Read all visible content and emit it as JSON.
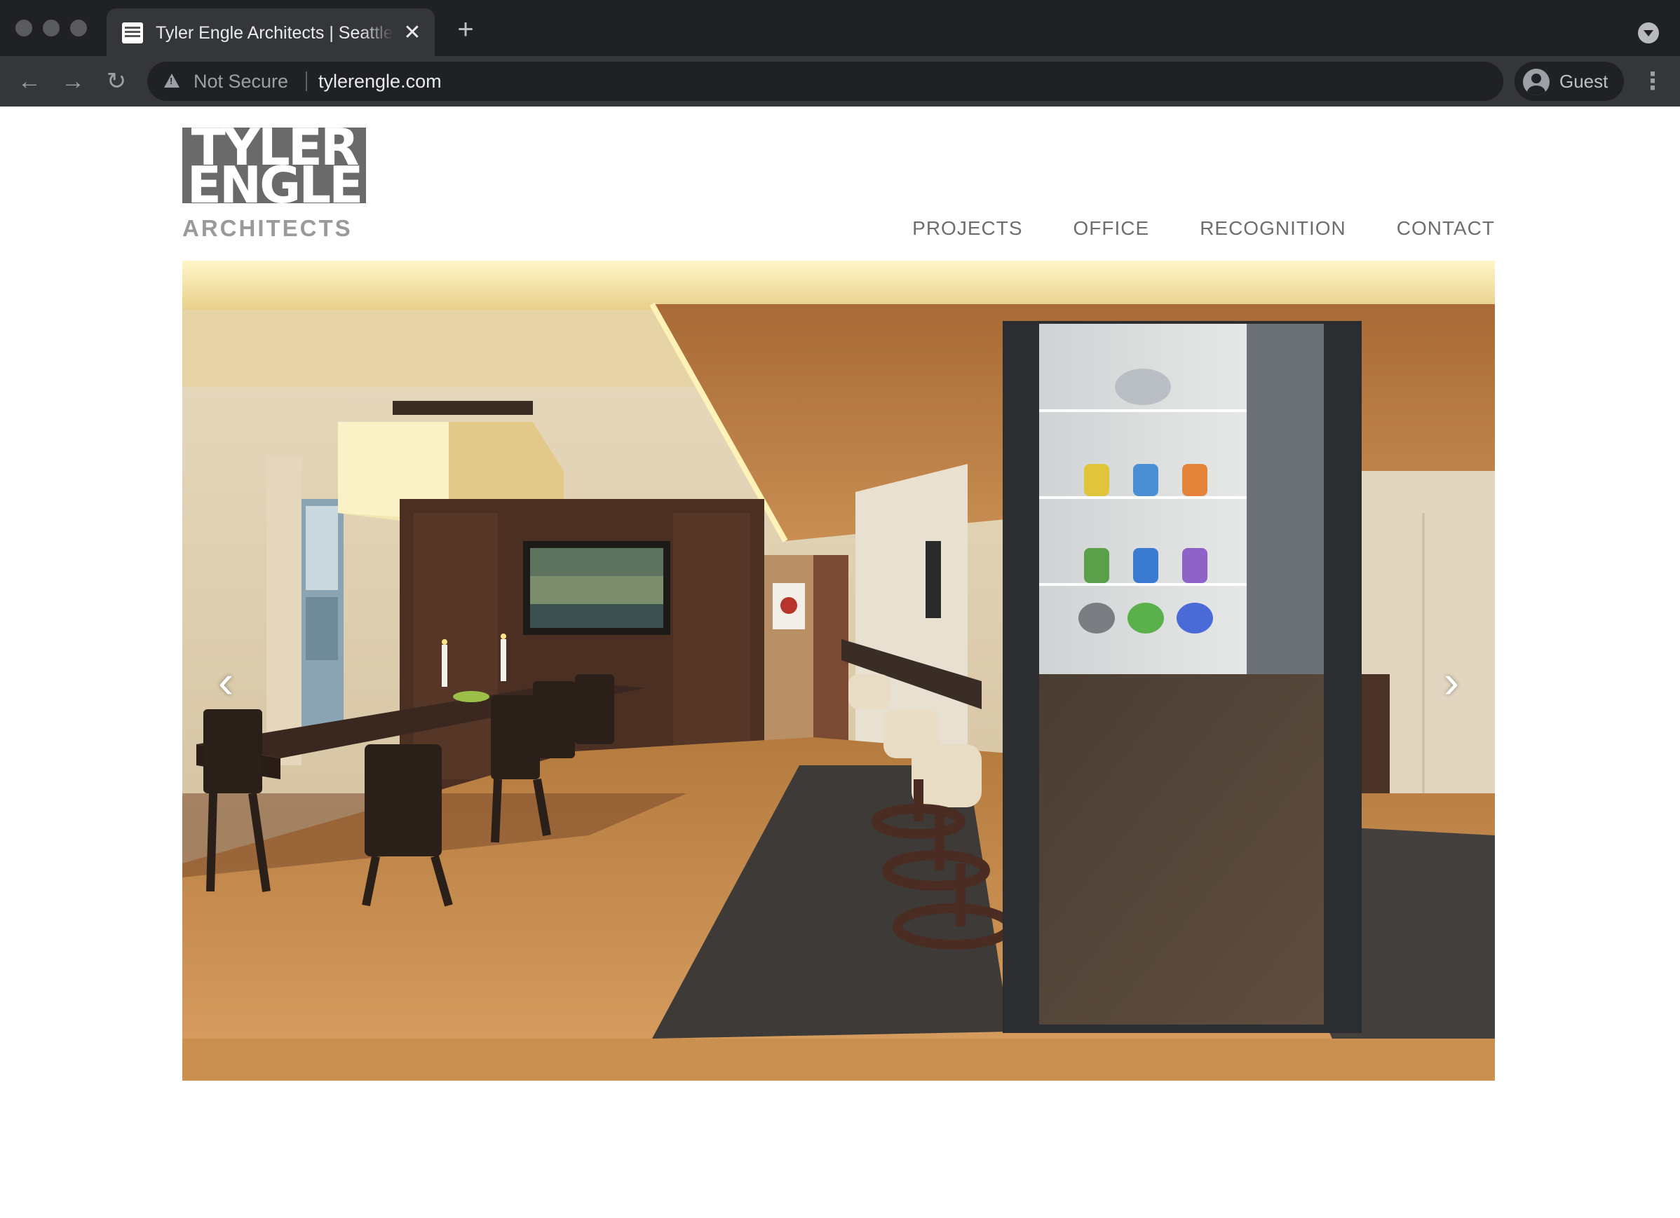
{
  "browser": {
    "tab_title": "Tyler Engle Architects | Seattle",
    "close_label": "✕",
    "new_tab_label": "+",
    "security_label": "Not Secure",
    "url": "tylerengle.com",
    "profile_label": "Guest",
    "back_label": "←",
    "forward_label": "→",
    "reload_label": "↻",
    "menu_label": "⋮"
  },
  "logo": {
    "line1": "TYLER",
    "line2": "ENGLE",
    "subtitle": "ARCHITECTS"
  },
  "nav": {
    "items": [
      {
        "label": "PROJECTS"
      },
      {
        "label": "OFFICE"
      },
      {
        "label": "RECOGNITION"
      },
      {
        "label": "CONTACT"
      }
    ]
  },
  "slider": {
    "prev_label": "‹",
    "next_label": "›"
  }
}
